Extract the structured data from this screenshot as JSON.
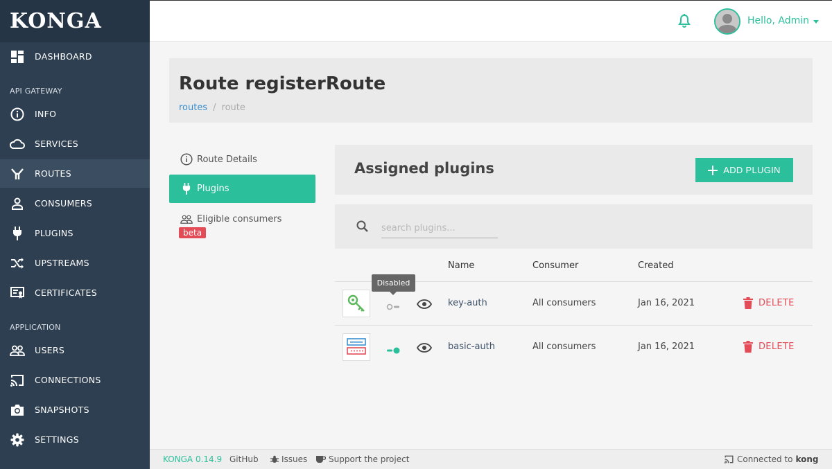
{
  "app": {
    "logo": "KONGA"
  },
  "sidebar": {
    "dashboard": "DASHBOARD",
    "section_api": "API GATEWAY",
    "info": "INFO",
    "services": "SERVICES",
    "routes": "ROUTES",
    "consumers": "CONSUMERS",
    "plugins": "PLUGINS",
    "upstreams": "UPSTREAMS",
    "certificates": "CERTIFICATES",
    "section_app": "APPLICATION",
    "users": "USERS",
    "connections": "CONNECTIONS",
    "snapshots": "SNAPSHOTS",
    "settings": "SETTINGS",
    "active_item": "ROUTES"
  },
  "topbar": {
    "greeting": "Hello, Admin"
  },
  "page": {
    "title": "Route registerRoute",
    "breadcrumb_link": "routes",
    "breadcrumb_sep": "/",
    "breadcrumb_current": "route"
  },
  "tabs": {
    "route_details": "Route Details",
    "plugins": "Plugins",
    "eligible_consumers": "Eligible consumers",
    "beta": "beta"
  },
  "plugins_panel": {
    "title": "Assigned plugins",
    "add_button": "ADD PLUGIN",
    "search_placeholder": "search plugins...",
    "columns": {
      "name": "Name",
      "consumer": "Consumer",
      "created": "Created"
    },
    "tooltip": "Disabled",
    "delete_label": "DELETE",
    "rows": [
      {
        "name": "key-auth",
        "consumer": "All consumers",
        "created": "Jan 16, 2021",
        "enabled": false
      },
      {
        "name": "basic-auth",
        "consumer": "All consumers",
        "created": "Jan 16, 2021",
        "enabled": true
      }
    ]
  },
  "footer": {
    "version": "KONGA 0.14.9",
    "github": "GitHub",
    "issues": "Issues",
    "support": "Support the project",
    "connected_prefix": "Connected to",
    "connected_name": "kong"
  },
  "colors": {
    "accent": "#2bbf9b",
    "sidebar": "#2e3f51",
    "danger": "#e34b57",
    "link": "#3b8fd0"
  }
}
